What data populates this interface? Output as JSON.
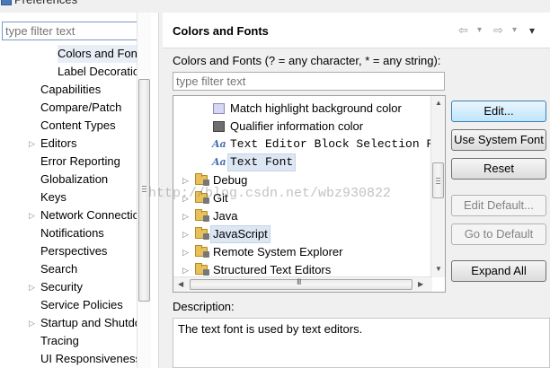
{
  "window": {
    "title": "Preferences"
  },
  "left": {
    "filter_placeholder": "type filter text",
    "items": [
      {
        "label": "Colors and Fonts",
        "depth": 2,
        "expand": ""
      },
      {
        "label": "Label Decorations",
        "depth": 2,
        "expand": ""
      },
      {
        "label": "Capabilities",
        "depth": 1,
        "expand": ""
      },
      {
        "label": "Compare/Patch",
        "depth": 1,
        "expand": ""
      },
      {
        "label": "Content Types",
        "depth": 1,
        "expand": ""
      },
      {
        "label": "Editors",
        "depth": 1,
        "expand": "▷"
      },
      {
        "label": "Error Reporting",
        "depth": 1,
        "expand": ""
      },
      {
        "label": "Globalization",
        "depth": 1,
        "expand": ""
      },
      {
        "label": "Keys",
        "depth": 1,
        "expand": ""
      },
      {
        "label": "Network Connections",
        "depth": 1,
        "expand": "▷"
      },
      {
        "label": "Notifications",
        "depth": 1,
        "expand": ""
      },
      {
        "label": "Perspectives",
        "depth": 1,
        "expand": ""
      },
      {
        "label": "Search",
        "depth": 1,
        "expand": ""
      },
      {
        "label": "Security",
        "depth": 1,
        "expand": "▷"
      },
      {
        "label": "Service Policies",
        "depth": 1,
        "expand": ""
      },
      {
        "label": "Startup and Shutdown",
        "depth": 1,
        "expand": "▷"
      },
      {
        "label": "Tracing",
        "depth": 1,
        "expand": ""
      },
      {
        "label": "UI Responsiveness",
        "depth": 1,
        "expand": ""
      }
    ]
  },
  "page": {
    "title": "Colors and Fonts",
    "nav": {
      "back": "⇦",
      "back_menu": "▾",
      "forward": "⇨",
      "forward_menu": "▾",
      "view_menu": "▾"
    },
    "section_label": "Colors and Fonts (? = any character, * = any string):",
    "filter_placeholder": "type filter text",
    "tree": [
      {
        "label": "Match highlight background color",
        "icon": "color-swatch-light",
        "indent": 2,
        "mono": false,
        "selected": false
      },
      {
        "label": "Qualifier information color",
        "icon": "color-swatch-dark",
        "indent": 2,
        "mono": false,
        "selected": false
      },
      {
        "label": "Text Editor Block Selection Font",
        "icon": "font-icon",
        "indent": 2,
        "mono": true,
        "selected": false
      },
      {
        "label": "Text Font",
        "icon": "font-icon",
        "indent": 2,
        "mono": true,
        "selected": true
      },
      {
        "label": "Debug",
        "icon": "folder-icon",
        "indent": 1,
        "mono": false,
        "selected": false
      },
      {
        "label": "Git",
        "icon": "folder-icon",
        "indent": 1,
        "mono": false,
        "selected": false
      },
      {
        "label": "Java",
        "icon": "folder-icon",
        "indent": 1,
        "mono": false,
        "selected": false
      },
      {
        "label": "JavaScript",
        "icon": "folder-icon",
        "indent": 1,
        "mono": false,
        "selected": true
      },
      {
        "label": "Remote System Explorer",
        "icon": "folder-icon",
        "indent": 1,
        "mono": false,
        "selected": false
      },
      {
        "label": "Structured Text Editors",
        "icon": "folder-icon",
        "indent": 1,
        "mono": false,
        "selected": false
      }
    ],
    "hscroll_grip": "III",
    "buttons": {
      "edit": "Edit...",
      "use_system_font": "Use System Font",
      "reset": "Reset",
      "edit_default": "Edit Default...",
      "go_to_default": "Go to Default",
      "expand_all": "Expand All"
    },
    "description_label": "Description:",
    "description_text": "The text font is used by text editors."
  },
  "watermark": "http://blog.csdn.net/wbz930822",
  "colors": {
    "accent": "#3c7fb1",
    "selection": "#dde7f4",
    "folder": "#e8c15a"
  }
}
